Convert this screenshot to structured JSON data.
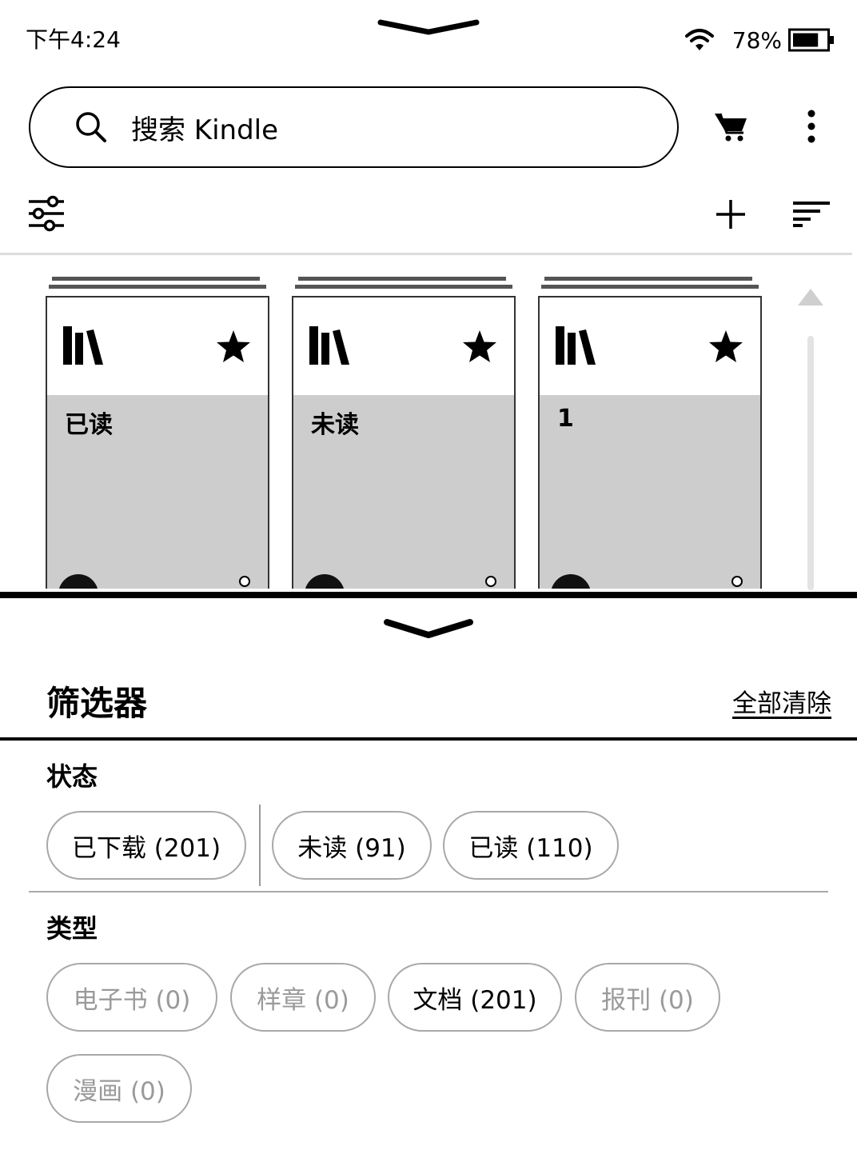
{
  "status": {
    "time": "下午4:24",
    "battery_percent": "78%",
    "battery_level": 0.78
  },
  "search": {
    "placeholder": "搜索 Kindle"
  },
  "collections": [
    {
      "name": "已读"
    },
    {
      "name": "未读"
    },
    {
      "name": "1"
    }
  ],
  "filters": {
    "title": "筛选器",
    "clear_all": "全部清除",
    "status_section": {
      "label": "状态",
      "chips": [
        {
          "label": "已下载 (201)",
          "enabled": true
        },
        {
          "label": "未读 (91)",
          "enabled": true
        },
        {
          "label": "已读 (110)",
          "enabled": true
        }
      ]
    },
    "type_section": {
      "label": "类型",
      "chips": [
        {
          "label": "电子书 (0)",
          "enabled": false
        },
        {
          "label": "样章 (0)",
          "enabled": false
        },
        {
          "label": "文档 (201)",
          "enabled": true
        },
        {
          "label": "报刊 (0)",
          "enabled": false
        },
        {
          "label": "漫画 (0)",
          "enabled": false
        }
      ]
    }
  },
  "icons": {
    "search": "search-icon",
    "cart": "cart-icon",
    "more": "more-vertical-icon",
    "filters": "sliders-icon",
    "add": "plus-icon",
    "sort": "sort-icon",
    "collection": "library-icon",
    "favorite": "star-icon"
  }
}
